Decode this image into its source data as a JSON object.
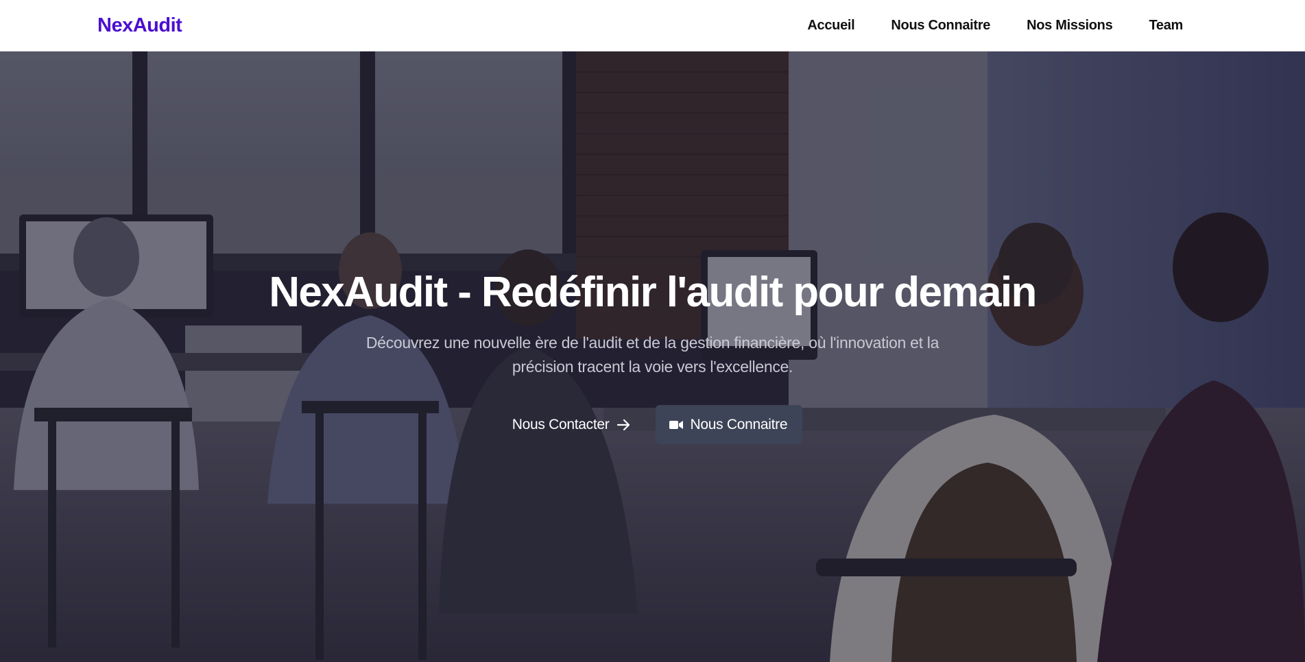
{
  "brand": {
    "name": "NexAudit",
    "color": "#4b0fd0"
  },
  "nav": {
    "items": [
      {
        "label": "Accueil"
      },
      {
        "label": "Nous Connaitre"
      },
      {
        "label": "Nos Missions"
      },
      {
        "label": "Team"
      }
    ]
  },
  "hero": {
    "background_image": "office-team-working-at-computers",
    "title": "NexAudit - Redéfinir l'audit pour demain",
    "subtitle": "Découvrez une nouvelle ère de l'audit et de la gestion financière, où l'innovation et la précision tracent la voie vers l'excellence.",
    "primary_button": {
      "label": "Nous Contacter",
      "icon": "arrow-right-icon"
    },
    "secondary_button": {
      "label": "Nous Connaitre",
      "icon": "video-camera-icon",
      "background": "#3d4457"
    }
  }
}
